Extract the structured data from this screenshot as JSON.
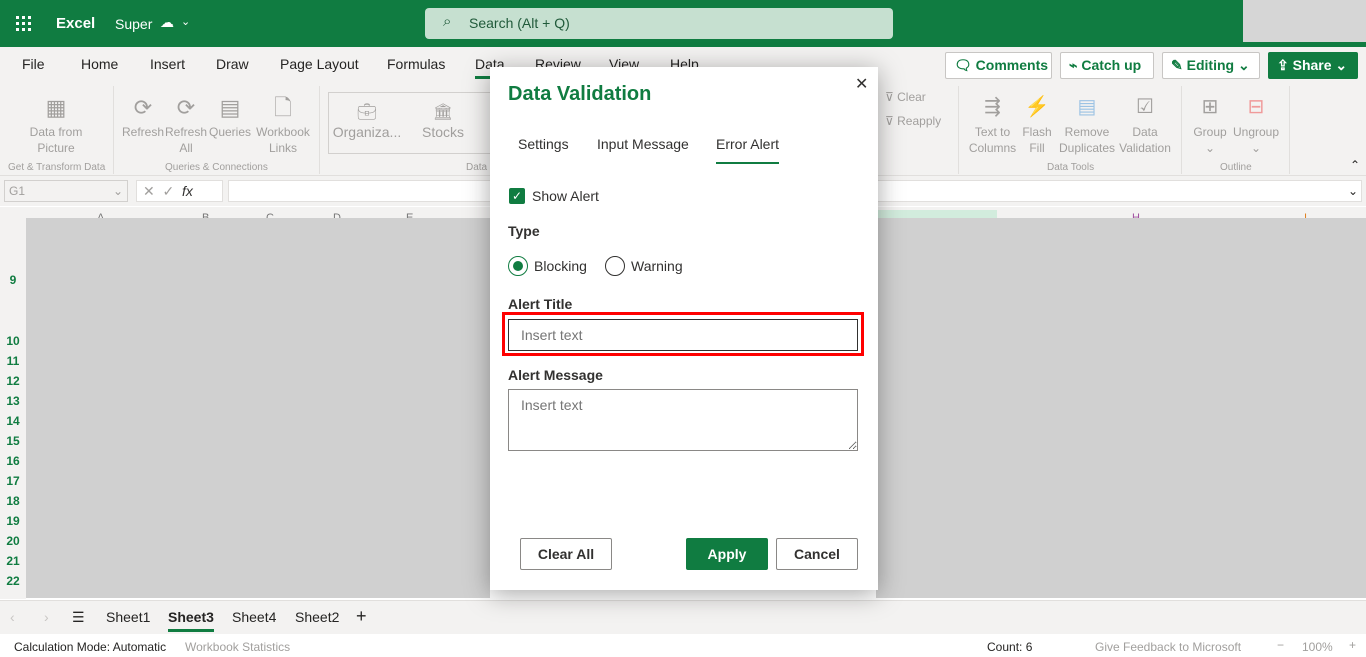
{
  "app": {
    "name": "Excel",
    "doc_name": "Super",
    "search_placeholder": "Search (Alt + Q)"
  },
  "colors": {
    "brand": "#107c41",
    "highlight": "#ff0000"
  },
  "ribbon_tabs": [
    "File",
    "Home",
    "Insert",
    "Draw",
    "Page Layout",
    "Formulas",
    "Data",
    "Review",
    "View",
    "Help"
  ],
  "active_tab": "Data",
  "header_buttons": {
    "comments": "Comments",
    "catch_up": "Catch up",
    "editing": "Editing",
    "share": "Share"
  },
  "ribbon": {
    "data_from_picture": "Data from Picture",
    "group1": "Get & Transform Data",
    "refresh": "Refresh",
    "refresh_all": "Refresh All",
    "queries": "Queries",
    "workbook_links": "Workbook Links",
    "group2": "Queries & Connections",
    "organization": "Organiza...",
    "stocks": "Stocks",
    "group3": "Data",
    "clear": "Clear",
    "reapply": "Reapply",
    "text_to_columns": "Text to Columns",
    "flash_fill": "Flash Fill",
    "remove_duplicates": "Remove Duplicates",
    "data_validation": "Data Validation",
    "group4": "Data Tools",
    "group": "Group",
    "ungroup": "Ungroup",
    "group5": "Outline"
  },
  "formula_bar": {
    "name_box": "G1",
    "fx": "fx",
    "value": ""
  },
  "columns": [
    "A",
    "B",
    "C",
    "D",
    "E",
    "H",
    "I"
  ],
  "rows": [
    "9",
    "10",
    "11",
    "12",
    "13",
    "14",
    "15",
    "16",
    "17",
    "18",
    "19",
    "20",
    "21",
    "22"
  ],
  "sheets": [
    "Sheet1",
    "Sheet3",
    "Sheet4",
    "Sheet2"
  ],
  "active_sheet": "Sheet3",
  "status": {
    "calc_mode": "Calculation Mode: Automatic",
    "workbook_stats": "Workbook Statistics",
    "count": "Count: 6",
    "feedback": "Give Feedback to Microsoft",
    "zoom": "100%"
  },
  "dialog": {
    "title": "Data Validation",
    "tabs": [
      "Settings",
      "Input Message",
      "Error Alert"
    ],
    "active_tab": "Error Alert",
    "show_alert_label": "Show Alert",
    "show_alert_checked": true,
    "type_label": "Type",
    "type_options": [
      "Blocking",
      "Warning"
    ],
    "type_selected": "Blocking",
    "alert_title_label": "Alert Title",
    "alert_title_value": "",
    "alert_title_placeholder": "Insert text",
    "alert_message_label": "Alert Message",
    "alert_message_value": "",
    "alert_message_placeholder": "Insert text",
    "clear_all": "Clear All",
    "apply": "Apply",
    "cancel": "Cancel"
  }
}
